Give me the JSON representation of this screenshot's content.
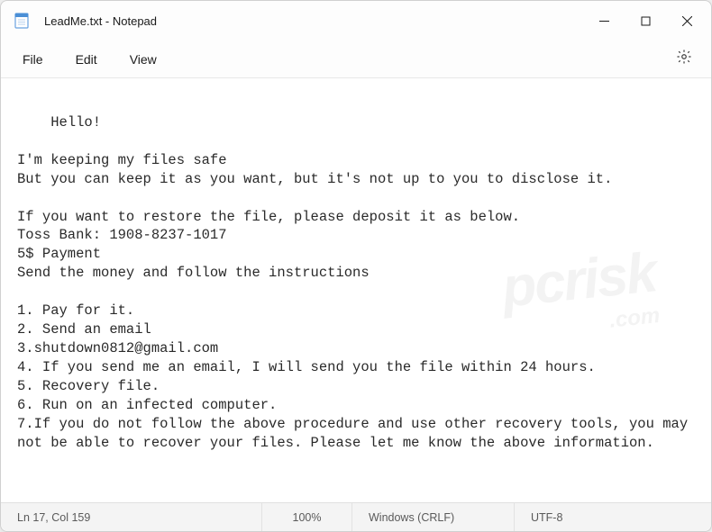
{
  "titlebar": {
    "title": "LeadMe.txt - Notepad"
  },
  "menu": {
    "file": "File",
    "edit": "Edit",
    "view": "View"
  },
  "document": {
    "content": "Hello!\n\nI'm keeping my files safe\nBut you can keep it as you want, but it's not up to you to disclose it.\n\nIf you want to restore the file, please deposit it as below.\nToss Bank: 1908-8237-1017\n5$ Payment\nSend the money and follow the instructions\n\n1. Pay for it.\n2. Send an email\n3.shutdown0812@gmail.com\n4. If you send me an email, I will send you the file within 24 hours.\n5. Recovery file.\n6. Run on an infected computer.\n7.If you do not follow the above procedure and use other recovery tools, you may not be able to recover your files. Please let me know the above information. "
  },
  "statusbar": {
    "position": "Ln 17, Col 159",
    "zoom": "100%",
    "eol": "Windows (CRLF)",
    "encoding": "UTF-8"
  }
}
